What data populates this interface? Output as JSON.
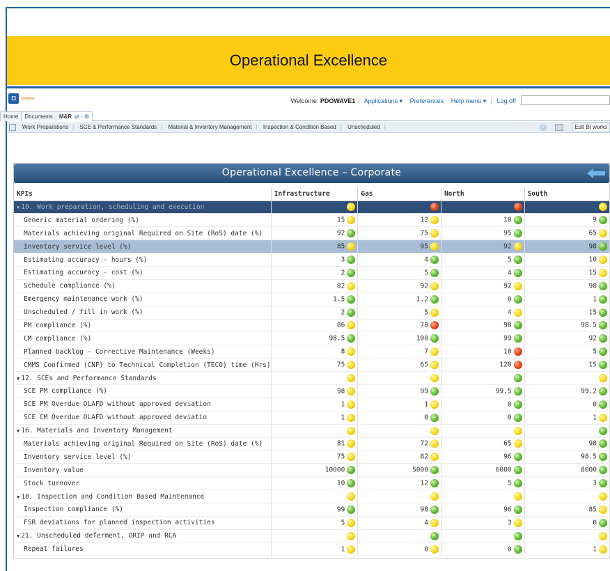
{
  "banner": {
    "title": "Operational Excellence"
  },
  "app": {
    "logo_text": "ShiftWay",
    "welcome_label": "Welcome:",
    "user": "PDOWAVE1",
    "menu": [
      "Applications",
      "Preferences",
      "Help menu",
      "Log off"
    ]
  },
  "tabs": [
    {
      "label": "Home"
    },
    {
      "label": "Documents"
    },
    {
      "label": "M&R"
    }
  ],
  "nav": {
    "items": [
      "Work Preparations",
      "SCE & Performance Standards",
      "Material & Inventory Management",
      "Inspection & Condition Based",
      "Unscheduled"
    ],
    "edit_button": "Edit BI works"
  },
  "dashboard": {
    "title": "Operational Excellence – Corporate",
    "columns": [
      "KPIs",
      "Infrastructure",
      "Gas",
      "North",
      "South"
    ],
    "rows": [
      {
        "type": "group-sel",
        "name": "10. Work preparation, scheduling and execution",
        "cells": [
          {
            "v": "",
            "s": "yellow"
          },
          {
            "v": "",
            "s": "red"
          },
          {
            "v": "",
            "s": "red"
          },
          {
            "v": "",
            "s": "yellow"
          }
        ]
      },
      {
        "type": "item",
        "name": "Generic material ordering  (%)",
        "cells": [
          {
            "v": "15",
            "s": "yellow"
          },
          {
            "v": "12",
            "s": "yellow"
          },
          {
            "v": "10",
            "s": "green"
          },
          {
            "v": "9",
            "s": "green"
          }
        ]
      },
      {
        "type": "item",
        "name": "Materials achieving original Required on Site (RoS) date  (%)",
        "cells": [
          {
            "v": "92",
            "s": "green"
          },
          {
            "v": "75",
            "s": "yellow"
          },
          {
            "v": "95",
            "s": "green"
          },
          {
            "v": "65",
            "s": "yellow"
          }
        ]
      },
      {
        "type": "highlight",
        "name": "Inventory service level (%)",
        "cells": [
          {
            "v": "85",
            "s": "yellow"
          },
          {
            "v": "95",
            "s": "yellow"
          },
          {
            "v": "92",
            "s": "yellow"
          },
          {
            "v": "98",
            "s": "green"
          }
        ]
      },
      {
        "type": "item",
        "name": "Estimating accuracy - hours (%)",
        "cells": [
          {
            "v": "3",
            "s": "green"
          },
          {
            "v": "4",
            "s": "green"
          },
          {
            "v": "5",
            "s": "green"
          },
          {
            "v": "10",
            "s": "yellow"
          }
        ]
      },
      {
        "type": "item",
        "name": "Estimating accuracy - cost  (%)",
        "cells": [
          {
            "v": "2",
            "s": "green"
          },
          {
            "v": "5",
            "s": "green"
          },
          {
            "v": "4",
            "s": "green"
          },
          {
            "v": "15",
            "s": "yellow"
          }
        ]
      },
      {
        "type": "item",
        "name": "Schedule compliance  (%)",
        "cells": [
          {
            "v": "82",
            "s": "yellow"
          },
          {
            "v": "92",
            "s": "yellow"
          },
          {
            "v": "92",
            "s": "yellow"
          },
          {
            "v": "98",
            "s": "green"
          }
        ]
      },
      {
        "type": "item",
        "name": "Emergency maintenance work  (%)",
        "cells": [
          {
            "v": "1.5",
            "s": "green"
          },
          {
            "v": "1.2",
            "s": "green"
          },
          {
            "v": "0",
            "s": "green"
          },
          {
            "v": "1",
            "s": "green"
          }
        ]
      },
      {
        "type": "item",
        "name": "Unscheduled / fill in work (%)",
        "cells": [
          {
            "v": "2",
            "s": "green"
          },
          {
            "v": "5",
            "s": "yellow"
          },
          {
            "v": "4",
            "s": "yellow"
          },
          {
            "v": "15",
            "s": "green"
          }
        ]
      },
      {
        "type": "item",
        "name": "PM compliance  (%)",
        "cells": [
          {
            "v": "86",
            "s": "yellow"
          },
          {
            "v": "78",
            "s": "red"
          },
          {
            "v": "98",
            "s": "green"
          },
          {
            "v": "98.5",
            "s": "green"
          }
        ]
      },
      {
        "type": "item",
        "name": "CM compliance  (%)",
        "cells": [
          {
            "v": "98.5",
            "s": "green"
          },
          {
            "v": "100",
            "s": "green"
          },
          {
            "v": "99",
            "s": "green"
          },
          {
            "v": "92",
            "s": "green"
          }
        ]
      },
      {
        "type": "item",
        "name": "Planned backlog - Corrective Maintenance (Weeks)",
        "cells": [
          {
            "v": "8",
            "s": "yellow"
          },
          {
            "v": "7",
            "s": "yellow"
          },
          {
            "v": "10",
            "s": "red"
          },
          {
            "v": "5",
            "s": "green"
          }
        ]
      },
      {
        "type": "item",
        "name": "CMMS Confirmed (CNF) to Technical Completion (TECO) time (Hrs)",
        "cells": [
          {
            "v": "75",
            "s": "yellow"
          },
          {
            "v": "65",
            "s": "yellow"
          },
          {
            "v": "120",
            "s": "red"
          },
          {
            "v": "15",
            "s": "green"
          }
        ]
      },
      {
        "type": "group",
        "name": "12. SCEs and Performance Standards",
        "cells": [
          {
            "v": "",
            "s": "yellow"
          },
          {
            "v": "",
            "s": "yellow"
          },
          {
            "v": "",
            "s": "green"
          },
          {
            "v": "",
            "s": "yellow"
          }
        ]
      },
      {
        "type": "item",
        "name": "SCE PM compliance (%)",
        "cells": [
          {
            "v": "98",
            "s": "yellow"
          },
          {
            "v": "99",
            "s": "green"
          },
          {
            "v": "99.5",
            "s": "green"
          },
          {
            "v": "99.2",
            "s": "green"
          }
        ]
      },
      {
        "type": "item",
        "name": "SCE PM Overdue OLAFD without approved deviation",
        "cells": [
          {
            "v": "1",
            "s": "yellow"
          },
          {
            "v": "1",
            "s": "yellow"
          },
          {
            "v": "0",
            "s": "green"
          },
          {
            "v": "0",
            "s": "green"
          }
        ]
      },
      {
        "type": "item",
        "name": "SCE CM Overdue OLAFD without approved deviatio",
        "cells": [
          {
            "v": "1",
            "s": "yellow"
          },
          {
            "v": "0",
            "s": "green"
          },
          {
            "v": "0",
            "s": "green"
          },
          {
            "v": "1",
            "s": "yellow"
          }
        ]
      },
      {
        "type": "group",
        "name": "16. Materials and Inventory Management",
        "cells": [
          {
            "v": "",
            "s": "yellow"
          },
          {
            "v": "",
            "s": "yellow"
          },
          {
            "v": "",
            "s": "yellow"
          },
          {
            "v": "",
            "s": "green"
          }
        ]
      },
      {
        "type": "item",
        "name": "Materials achieving original Required on Site (RoS) date  (%)",
        "cells": [
          {
            "v": "81",
            "s": "yellow"
          },
          {
            "v": "72",
            "s": "yellow"
          },
          {
            "v": "65",
            "s": "yellow"
          },
          {
            "v": "98",
            "s": "green"
          }
        ]
      },
      {
        "type": "item",
        "name": "Inventory service level  (%)",
        "cells": [
          {
            "v": "75",
            "s": "yellow"
          },
          {
            "v": "82",
            "s": "yellow"
          },
          {
            "v": "96",
            "s": "green"
          },
          {
            "v": "98.5",
            "s": "green"
          }
        ]
      },
      {
        "type": "item",
        "name": "Inventory value",
        "cells": [
          {
            "v": "10000",
            "s": "green"
          },
          {
            "v": "5000",
            "s": "green"
          },
          {
            "v": "6000",
            "s": "green"
          },
          {
            "v": "8000",
            "s": "green"
          }
        ]
      },
      {
        "type": "item",
        "name": "Stock turnover",
        "cells": [
          {
            "v": "10",
            "s": "green"
          },
          {
            "v": "12",
            "s": "green"
          },
          {
            "v": "5",
            "s": "green"
          },
          {
            "v": "3",
            "s": "green"
          }
        ]
      },
      {
        "type": "group",
        "name": "18. Inspection and Condition Based Maintenance",
        "cells": [
          {
            "v": "",
            "s": "yellow"
          },
          {
            "v": "",
            "s": "yellow"
          },
          {
            "v": "",
            "s": "yellow"
          },
          {
            "v": "",
            "s": "yellow"
          }
        ]
      },
      {
        "type": "item",
        "name": "Inspection compliance (%)",
        "cells": [
          {
            "v": "99",
            "s": "green"
          },
          {
            "v": "98",
            "s": "green"
          },
          {
            "v": "96",
            "s": "green"
          },
          {
            "v": "85",
            "s": "yellow"
          }
        ]
      },
      {
        "type": "item",
        "name": "FSR deviations for planned inspection activities",
        "cells": [
          {
            "v": "5",
            "s": "yellow"
          },
          {
            "v": "4",
            "s": "yellow"
          },
          {
            "v": "3",
            "s": "yellow"
          },
          {
            "v": "0",
            "s": "green"
          }
        ]
      },
      {
        "type": "group",
        "name": "21. Unscheduled deferment, ORIP and RCA",
        "cells": [
          {
            "v": "",
            "s": "yellow"
          },
          {
            "v": "",
            "s": "green"
          },
          {
            "v": "",
            "s": "green"
          },
          {
            "v": "",
            "s": "yellow"
          }
        ]
      },
      {
        "type": "item",
        "name": "Repeat failures",
        "cells": [
          {
            "v": "1",
            "s": "yellow"
          },
          {
            "v": "0",
            "s": "yellow"
          },
          {
            "v": "0",
            "s": "green"
          },
          {
            "v": "1",
            "s": "yellow"
          }
        ]
      }
    ]
  }
}
